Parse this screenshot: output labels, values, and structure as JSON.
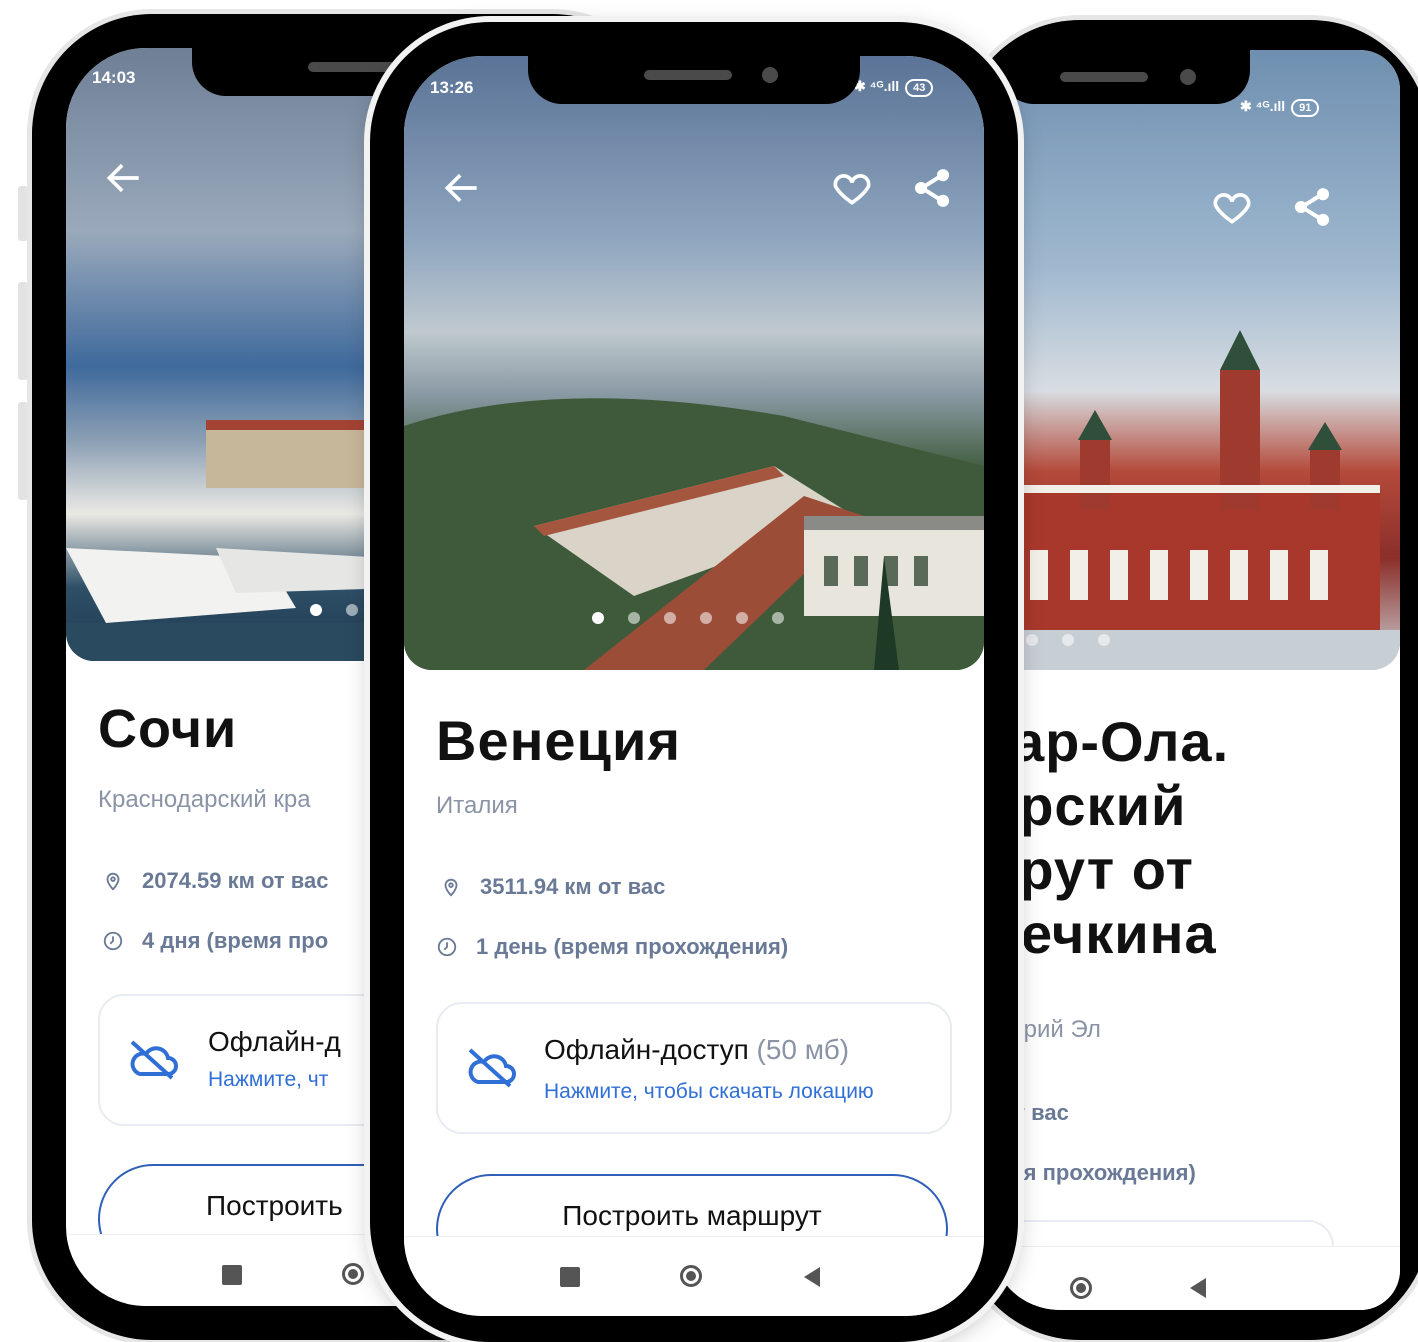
{
  "phones": {
    "left": {
      "status_time": "14:03",
      "title": "Сочи",
      "region": "Краснодарский кра",
      "distance": "2074.59 км от вас",
      "duration": "4 дня (время про",
      "offline_title": "Офлайн-д",
      "offline_hint": "Нажмите, чт",
      "route_button": "Построить"
    },
    "center": {
      "status_time": "13:26",
      "battery": "43",
      "title": "Венеция",
      "region": "Италия",
      "distance": "3511.94 км от вас",
      "duration": "1 день (время прохождения)",
      "offline_title": "Офлайн-доступ",
      "offline_size": "(50 мб)",
      "offline_hint": "Нажмите, чтобы скачать локацию",
      "route_button": "Построить маршрут"
    },
    "right": {
      "battery": "91",
      "title_lines": [
        "кар-Ола.",
        "орский",
        "ирут от",
        "Речкина"
      ],
      "region": "Марий Эл",
      "distance": "н от вас",
      "duration": "ремя прохождения)"
    }
  },
  "colors": {
    "accent": "#2f6fd6",
    "button_border": "#2f5fb8",
    "muted_text": "#8a94a6",
    "meta_text": "#6a7a96"
  },
  "icons": [
    "back-arrow-icon",
    "heart-icon",
    "share-icon",
    "location-pin-icon",
    "clock-icon",
    "cloud-off-icon",
    "nav-square-icon",
    "nav-home-icon",
    "nav-back-icon"
  ]
}
